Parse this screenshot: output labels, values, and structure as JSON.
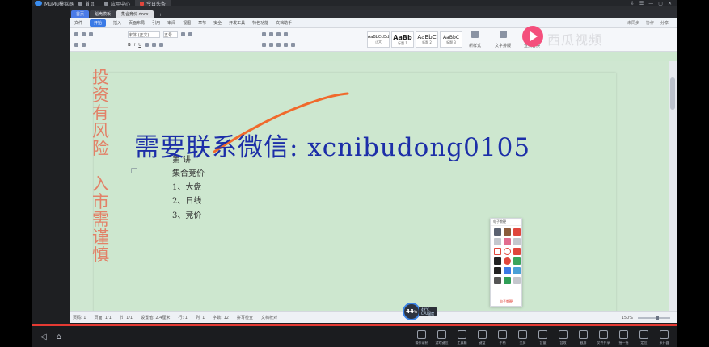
{
  "emulator": {
    "title": "MuMu模拟器",
    "tabs": [
      {
        "label": "首页"
      },
      {
        "label": "应用中心"
      },
      {
        "label": "今日头条"
      }
    ],
    "window_controls": [
      "⇩",
      "☰",
      "—",
      "▢",
      "✕"
    ],
    "nav": [
      "◁",
      "⌂"
    ],
    "tools": [
      {
        "label": "操作录制",
        "icon": "record-icon"
      },
      {
        "label": "游戏键位",
        "icon": "gamepad-icon"
      },
      {
        "label": "工具箱",
        "icon": "toolbox-icon"
      },
      {
        "label": "键盘",
        "icon": "keyboard-icon"
      },
      {
        "label": "手柄",
        "icon": "controller-icon"
      },
      {
        "label": "全屏",
        "icon": "fullscreen-icon"
      },
      {
        "label": "音量",
        "icon": "volume-icon"
      },
      {
        "label": "音效",
        "icon": "sound-icon"
      },
      {
        "label": "截屏",
        "icon": "screenshot-icon"
      },
      {
        "label": "文件共享",
        "icon": "share-icon"
      },
      {
        "label": "摇一摇",
        "icon": "shake-icon"
      },
      {
        "label": "定位",
        "icon": "location-icon"
      },
      {
        "label": "多开器",
        "icon": "multi-icon"
      }
    ]
  },
  "wps": {
    "tabs": [
      {
        "label": "首页"
      },
      {
        "label": "稻壳模板"
      },
      {
        "label": "集合竞价.docx"
      }
    ],
    "menu": [
      "文件",
      "开始",
      "插入",
      "页面布局",
      "引用",
      "审阅",
      "视图",
      "章节",
      "安全",
      "开发工具",
      "特色功能",
      "文档助手"
    ],
    "menu_active": "开始",
    "menu_right": [
      "未同步",
      "协作",
      "分享"
    ],
    "font_name": "宋体 (正文)",
    "font_size": "五号",
    "styles": [
      {
        "sample": "AaBbCcDd",
        "caption": "正文"
      },
      {
        "sample": "AaBb",
        "caption": "标题 1"
      },
      {
        "sample": "AaBbC",
        "caption": "标题 2"
      },
      {
        "sample": "AaBbC",
        "caption": "标题 3"
      }
    ],
    "ribbon_right": [
      "新样式",
      "文字排版",
      "查找替换"
    ]
  },
  "document": {
    "lines": [
      "第  讲",
      "集合竞价",
      "1、大盘",
      "2、日线",
      "3、竞价"
    ]
  },
  "status_bar": {
    "items": [
      "页码: 1",
      "页面: 1/1",
      "节: 1/1",
      "设置值: 2.4厘米",
      "行: 1",
      "列: 1",
      "字数: 12",
      "拼写检查",
      "文档校对"
    ],
    "zoom": "150%"
  },
  "cpu": {
    "percent": "44",
    "unit": "%",
    "temp": "49°C",
    "label": "CPU温度"
  },
  "pen_panel": {
    "title": "电子教鞭",
    "footer": "电子教鞭"
  },
  "overlay": {
    "warning_vertical_1": "投资有风险",
    "warning_vertical_2": "入市需谨慎",
    "contact": "需要联系微信: xcnibudong0105"
  },
  "watermark": "西瓜视频",
  "colors": {
    "accent": "#3a7ae6",
    "doc_background": "#cde7cf",
    "overlay_text": "#1c2ea8",
    "warning_text": "#e7684e",
    "pen_stroke": "#f06a2c"
  }
}
